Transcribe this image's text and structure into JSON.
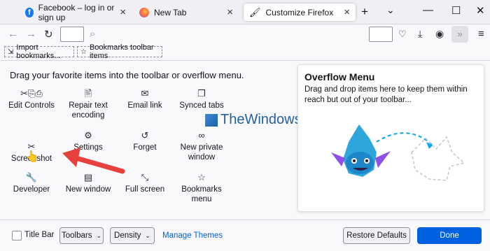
{
  "tabs": [
    {
      "title": "Facebook – log in or sign up",
      "close": "×"
    },
    {
      "title": "New Tab",
      "close": "×"
    },
    {
      "title": "Customize Firefox",
      "close": "×"
    }
  ],
  "tabbar": {
    "new_tab": "+",
    "list_tabs": "⌄"
  },
  "window_controls": {
    "minimize": "—",
    "maximize": "☐",
    "close": "✕"
  },
  "bookmarks": [
    {
      "label": "Import bookmarks..."
    },
    {
      "label": "Bookmarks toolbar items"
    }
  ],
  "palette": {
    "heading": "Drag your favorite items into the toolbar or overflow menu.",
    "items": [
      {
        "label": "Edit Controls",
        "icon": "edit-controls-icon"
      },
      {
        "label": "Repair text encoding",
        "icon": "text-encoding-icon"
      },
      {
        "label": "Email link",
        "icon": "email-icon"
      },
      {
        "label": "Synced tabs",
        "icon": "synced-tabs-icon"
      },
      {
        "label": "Screenshot",
        "icon": "screenshot-icon"
      },
      {
        "label": "Settings",
        "icon": "gear-icon"
      },
      {
        "label": "Forget",
        "icon": "forget-icon"
      },
      {
        "label": "New private window",
        "icon": "private-mask-icon"
      },
      {
        "label": "Developer",
        "icon": "wrench-icon"
      },
      {
        "label": "New window",
        "icon": "window-icon"
      },
      {
        "label": "Full screen",
        "icon": "fullscreen-icon"
      },
      {
        "label": "Bookmarks menu",
        "icon": "bookmark-star-icon"
      }
    ]
  },
  "overflow_menu": {
    "title": "Overflow Menu",
    "description": "Drag and drop items here to keep them within reach but out of your toolbar..."
  },
  "watermark": {
    "text": "TheWindowsClub"
  },
  "footer": {
    "title_bar": "Title Bar",
    "toolbars": "Toolbars",
    "density": "Density",
    "manage_themes": "Manage Themes",
    "restore_defaults": "Restore Defaults",
    "done": "Done"
  },
  "colors": {
    "accent": "#0061e0",
    "annotation_arrow": "#e8403c"
  }
}
